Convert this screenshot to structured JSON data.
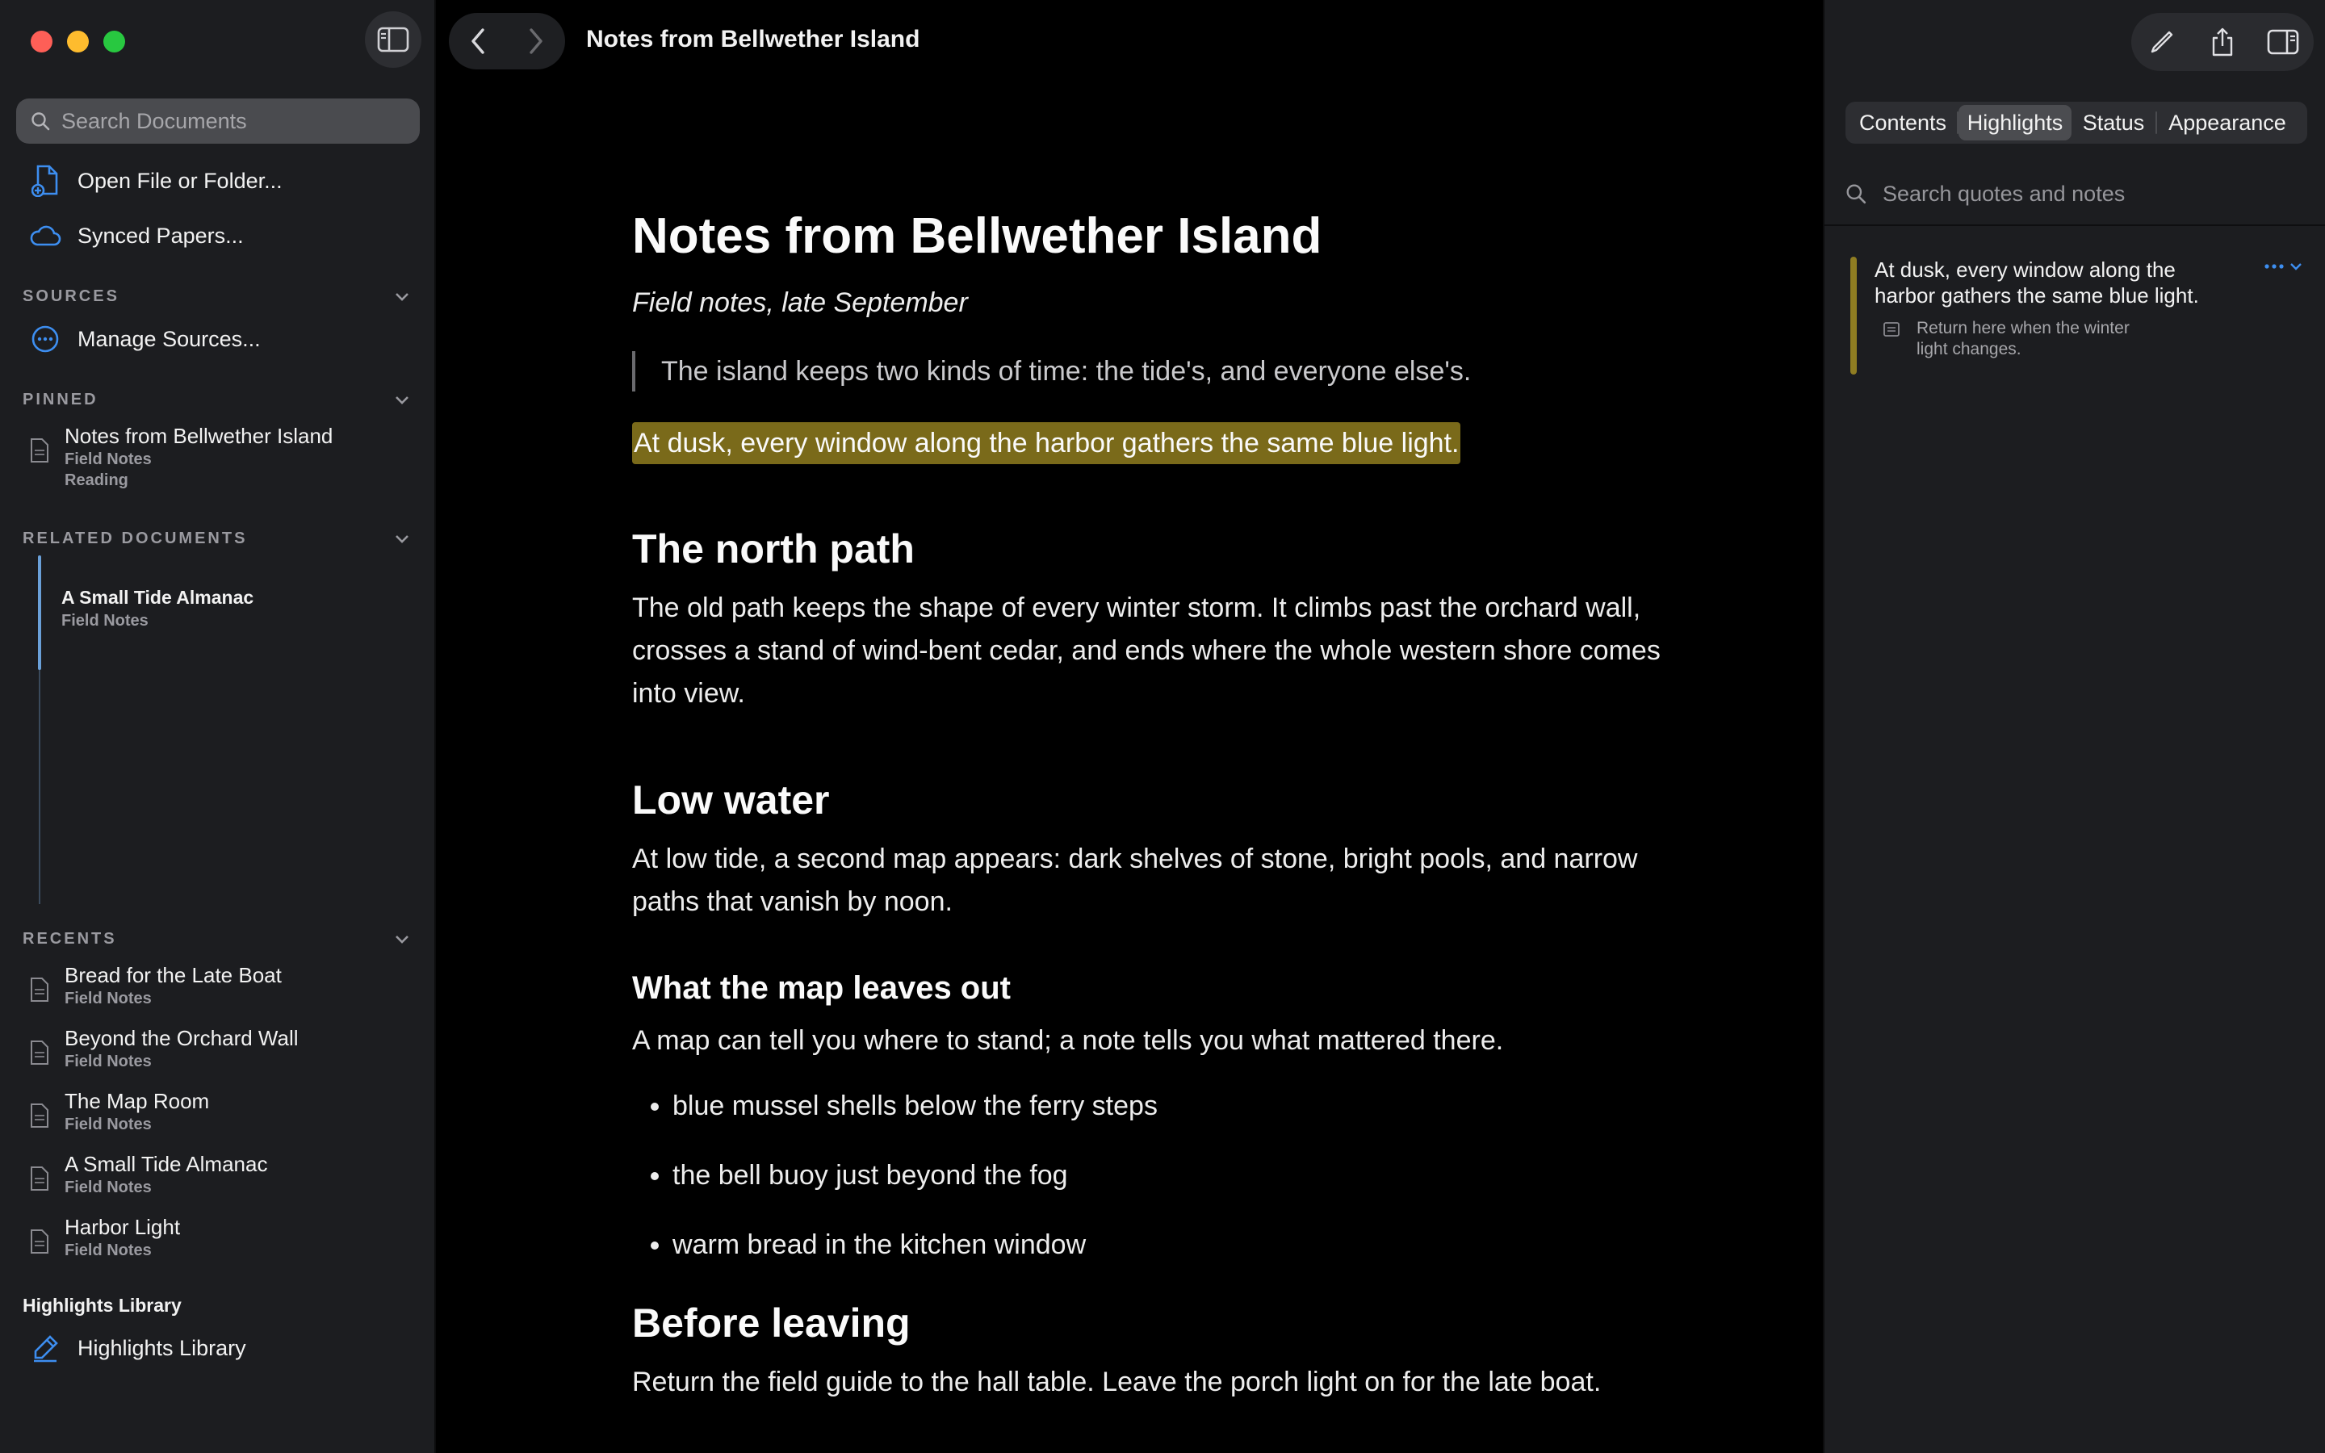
{
  "window_title": "Notes from Bellwether Island",
  "sidebar": {
    "search_placeholder": "Search Documents",
    "open_file": "Open File or Folder...",
    "synced_papers": "Synced Papers...",
    "sources_header": "SOURCES",
    "manage_sources": "Manage Sources...",
    "pinned_header": "PINNED",
    "pinned": [
      {
        "title": "Notes from Bellwether Island",
        "subtitle": "Field Notes",
        "status": "Reading"
      }
    ],
    "related_header": "RELATED DOCUMENTS",
    "related": [
      {
        "title": "A Small Tide Almanac",
        "subtitle": "Field Notes"
      }
    ],
    "recents_header": "RECENTS",
    "recents": [
      {
        "title": "Bread for the Late Boat",
        "subtitle": "Field Notes"
      },
      {
        "title": "Beyond the Orchard Wall",
        "subtitle": "Field Notes"
      },
      {
        "title": "The Map Room",
        "subtitle": "Field Notes"
      },
      {
        "title": "A Small Tide Almanac",
        "subtitle": "Field Notes"
      },
      {
        "title": "Harbor Light",
        "subtitle": "Field Notes"
      }
    ],
    "library_header": "Highlights Library",
    "library_item": "Highlights Library"
  },
  "document": {
    "title": "Notes from Bellwether Island",
    "subtitle": "Field notes, late September",
    "quote": "The island keeps two kinds of time: the tide's, and everyone else's.",
    "highlight": "At dusk, every window along the harbor gathers the same blue light.",
    "h_north": "The north path",
    "p_north": "The old path keeps the shape of every winter storm. It climbs past the orchard wall, crosses a stand of wind-bent cedar, and ends where the whole western shore comes into view.",
    "h_low": "Low water",
    "p_low": "At low tide, a second map appears: dark shelves of stone, bright pools, and narrow paths that vanish by noon.",
    "h_map": "What the map leaves out",
    "p_map": "A map can tell you where to stand; a note tells you what mattered there.",
    "bullets": [
      "blue mussel shells below the ferry steps",
      "the bell buoy just beyond the fog",
      "warm bread in the kitchen window"
    ],
    "h_leaving": "Before leaving",
    "p_leaving": "Return the field guide to the hall table. Leave the porch light on for the late boat."
  },
  "inspector": {
    "tabs": [
      "Contents",
      "Highlights",
      "Status",
      "Appearance"
    ],
    "active_tab": "Highlights",
    "search_placeholder": "Search quotes and notes",
    "highlight_card": {
      "quote": "At dusk, every window along the harbor gathers the same blue light.",
      "note": "Return here when the winter light changes."
    }
  },
  "colors": {
    "highlight": "#7a6a1a",
    "highlight_bar": "#8f7d22",
    "accent": "#3d8ef0",
    "sidebar_bg": "#1c1d20"
  }
}
